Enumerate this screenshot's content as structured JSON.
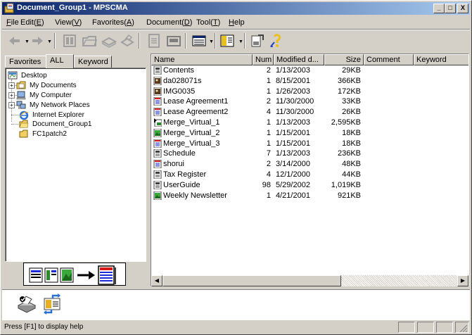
{
  "window": {
    "title": "Document_Group1 - MPSCMA",
    "min_label": "_",
    "max_label": "□",
    "close_label": "X"
  },
  "menu": [
    {
      "pre": "",
      "key": "F",
      "post": "ile"
    },
    {
      "pre": "Edit(",
      "key": "E",
      "post": ")"
    },
    {
      "pre": "View(",
      "key": "V",
      "post": ")"
    },
    {
      "pre": "Favorites(",
      "key": "A",
      "post": ")"
    },
    {
      "pre": "Document(",
      "key": "D",
      "post": ")"
    },
    {
      "pre": "Tool(",
      "key": "T",
      "post": ")"
    },
    {
      "pre": "",
      "key": "H",
      "post": "elp"
    }
  ],
  "toolbar": {
    "icons": [
      "back-icon",
      "forward-icon",
      "thumbnail-icon",
      "folder-icon",
      "scan-icon",
      "print-icon",
      "document-view-icon",
      "fax-icon",
      "list-view-icon",
      "column-view-icon",
      "share-icon",
      "help-icon"
    ]
  },
  "tabs": [
    {
      "label": "Favorites"
    },
    {
      "label": "ALL"
    },
    {
      "label": "Keyword"
    }
  ],
  "tree": [
    {
      "label": "Desktop",
      "icon": "desktop-icon"
    },
    {
      "label": "My Documents",
      "icon": "my-documents-icon"
    },
    {
      "label": "My Computer",
      "icon": "my-computer-icon"
    },
    {
      "label": "My Network Places",
      "icon": "network-icon"
    },
    {
      "label": "Internet Explorer",
      "icon": "internet-explorer-icon"
    },
    {
      "label": "Document_Group1",
      "icon": "folder-icon"
    },
    {
      "label": "FC1patch2",
      "icon": "folder-icon"
    }
  ],
  "columns": {
    "name": "Name",
    "num": "Num",
    "modified": "Modified d...",
    "size": "Size",
    "comment": "Comment",
    "keyword": "Keyword"
  },
  "files": [
    {
      "name": "Contents",
      "num": "2",
      "modified": "1/13/2003",
      "size": "29KB",
      "icon": "document-icon"
    },
    {
      "name": "da028071s",
      "num": "1",
      "modified": "8/15/2001",
      "size": "366KB",
      "icon": "image-document-icon"
    },
    {
      "name": "IMG0035",
      "num": "1",
      "modified": "1/26/2003",
      "size": "172KB",
      "icon": "image-document-icon"
    },
    {
      "name": "Lease Agreement1",
      "num": "2",
      "modified": "11/30/2000",
      "size": "33KB",
      "icon": "form-document-icon"
    },
    {
      "name": "Lease Agreement2",
      "num": "4",
      "modified": "11/30/2000",
      "size": "26KB",
      "icon": "form-document-icon"
    },
    {
      "name": "Merge_Virtual_1",
      "num": "1",
      "modified": "1/13/2003",
      "size": "2,595KB",
      "icon": "virtual-document-icon"
    },
    {
      "name": "Merge_Virtual_2",
      "num": "1",
      "modified": "1/15/2001",
      "size": "18KB",
      "icon": "picture-document-icon"
    },
    {
      "name": "Merge_Virtual_3",
      "num": "1",
      "modified": "1/15/2001",
      "size": "18KB",
      "icon": "form-document-icon"
    },
    {
      "name": "Schedule",
      "num": "7",
      "modified": "1/13/2003",
      "size": "236KB",
      "icon": "document-icon"
    },
    {
      "name": "shorui",
      "num": "2",
      "modified": "3/14/2000",
      "size": "48KB",
      "icon": "form-document-icon"
    },
    {
      "name": "Tax Register",
      "num": "4",
      "modified": "12/1/2000",
      "size": "44KB",
      "icon": "document-icon"
    },
    {
      "name": "UserGuide",
      "num": "98",
      "modified": "5/29/2002",
      "size": "1,019KB",
      "icon": "document-icon"
    },
    {
      "name": "Weekly Newsletter",
      "num": "1",
      "modified": "4/21/2001",
      "size": "921KB",
      "icon": "picture-document-icon"
    }
  ],
  "status": {
    "text": "Press [F1] to display help"
  },
  "colors": {
    "title_bar_start": "#0a246a",
    "title_bar_end": "#a6caf0",
    "face": "#d4d0c8"
  }
}
